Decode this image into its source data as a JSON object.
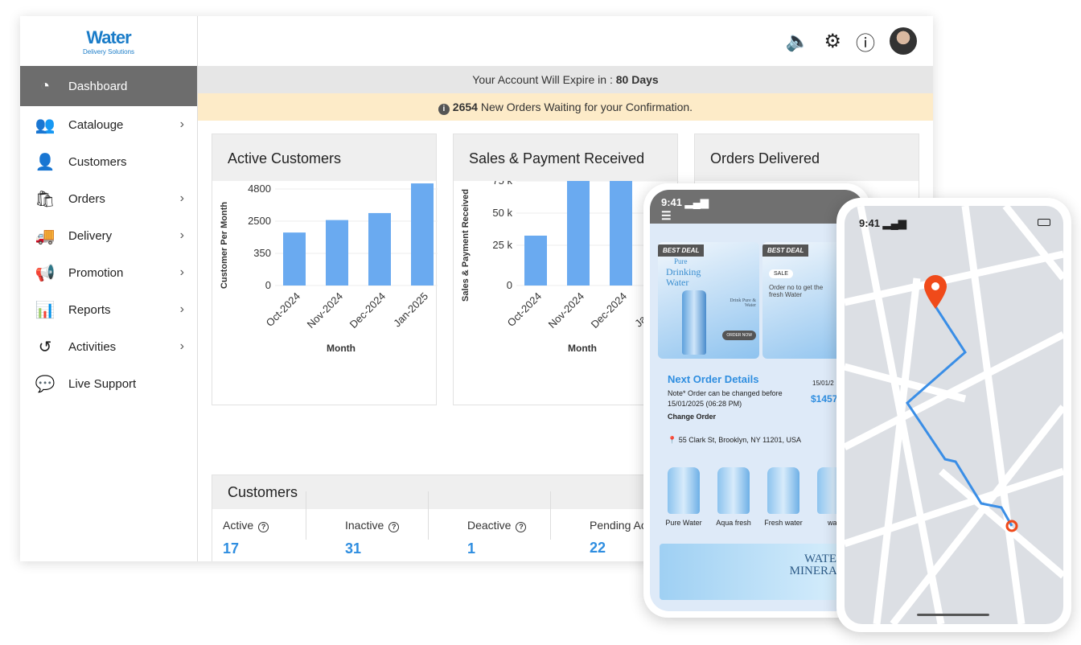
{
  "logo": {
    "name": "Water",
    "tagline": "Delivery Solutions"
  },
  "sidebar": {
    "items": [
      {
        "label": "Dashboard",
        "icon": "gauge-icon",
        "active": true,
        "chevron": false
      },
      {
        "label": "Catalouge",
        "icon": "people-hand-icon",
        "chevron": true
      },
      {
        "label": "Customers",
        "icon": "user-icon",
        "chevron": false
      },
      {
        "label": "Orders",
        "icon": "shopping-bag-icon",
        "chevron": true
      },
      {
        "label": "Delivery",
        "icon": "truck-icon",
        "chevron": true
      },
      {
        "label": "Promotion",
        "icon": "megaphone-icon",
        "chevron": true
      },
      {
        "label": "Reports",
        "icon": "bar-chart-icon",
        "chevron": true
      },
      {
        "label": "Activities",
        "icon": "history-icon",
        "chevron": true
      },
      {
        "label": "Live Support",
        "icon": "chat-icon",
        "chevron": false
      }
    ]
  },
  "header": {
    "icons": [
      "speaker-icon",
      "gear-icon",
      "help-icon",
      "avatar"
    ]
  },
  "banners": {
    "expire_prefix": "Your Account Will Expire in : ",
    "expire_value": "80 Days",
    "orders_count": "2654",
    "orders_text": " New Orders Waiting for your Confirmation."
  },
  "cards": {
    "active_customers": "Active Customers",
    "sales": "Sales & Payment Received",
    "orders_delivered": "Orders Delivered"
  },
  "chart_data": [
    {
      "type": "bar",
      "title": "Active Customers",
      "xlabel": "Month",
      "ylabel": "Customer Per Month",
      "categories": [
        "Oct-2024",
        "Nov-2024",
        "Dec-2024",
        "Jan-2025"
      ],
      "values": [
        1740,
        2580,
        3080,
        5200
      ],
      "yticks": [
        0,
        350,
        2500,
        4800
      ],
      "ytick_labels": [
        "0",
        "350",
        "2500",
        "4800"
      ],
      "color": "#6aaaf0",
      "grid": true
    },
    {
      "type": "bar",
      "title": "Sales & Payment Received",
      "xlabel": "Month",
      "ylabel": "Sales & Payment Received",
      "categories": [
        "Oct-2024",
        "Nov-2024",
        "Dec-2024",
        "Jan-2025"
      ],
      "values": [
        32500,
        81000,
        103000,
        null
      ],
      "yticks": [
        0,
        25000,
        50000,
        75000,
        100000
      ],
      "ytick_labels": [
        "0",
        "25 k",
        "50 k",
        "75 k",
        "100 k"
      ],
      "color": "#6aaaf0",
      "grid": true
    }
  ],
  "customers": {
    "title": "Customers",
    "stats": [
      {
        "label": "Active",
        "value": "17"
      },
      {
        "label": "Inactive",
        "value": "31"
      },
      {
        "label": "Deactive",
        "value": "1"
      },
      {
        "label": "Pending Ac",
        "value": "22"
      }
    ]
  },
  "phone1": {
    "time": "9:41",
    "deal_tag": "BEST DEAL",
    "deal1": {
      "l1": "Pure",
      "l2": "Drinking",
      "l3": "Water",
      "side": "Drink Pure & Water",
      "btn": "ORDER NOW"
    },
    "deal2": {
      "sale": "SALE",
      "text": "Order no to get the fresh Water"
    },
    "next_order": {
      "title": "Next Order Details",
      "note": "Note* Order can be changed before 15/01/2025 (06:28 PM)",
      "link": "Change Order",
      "date": "15/01/2",
      "amount": "$1457"
    },
    "address": "55 Clark St, Brooklyn, NY 11201, USA",
    "products": [
      "Pure Water",
      "Aqua fresh",
      "Fresh water",
      "wat"
    ],
    "promo": {
      "l1": "WATER",
      "l2": "MINERAL"
    }
  },
  "phone2": {
    "time": "9:41"
  },
  "colors": {
    "accent": "#2f8ee0",
    "sidebar_active": "#6d6d6d",
    "route": "#3a8ee6",
    "pin": "#f04a1a"
  }
}
